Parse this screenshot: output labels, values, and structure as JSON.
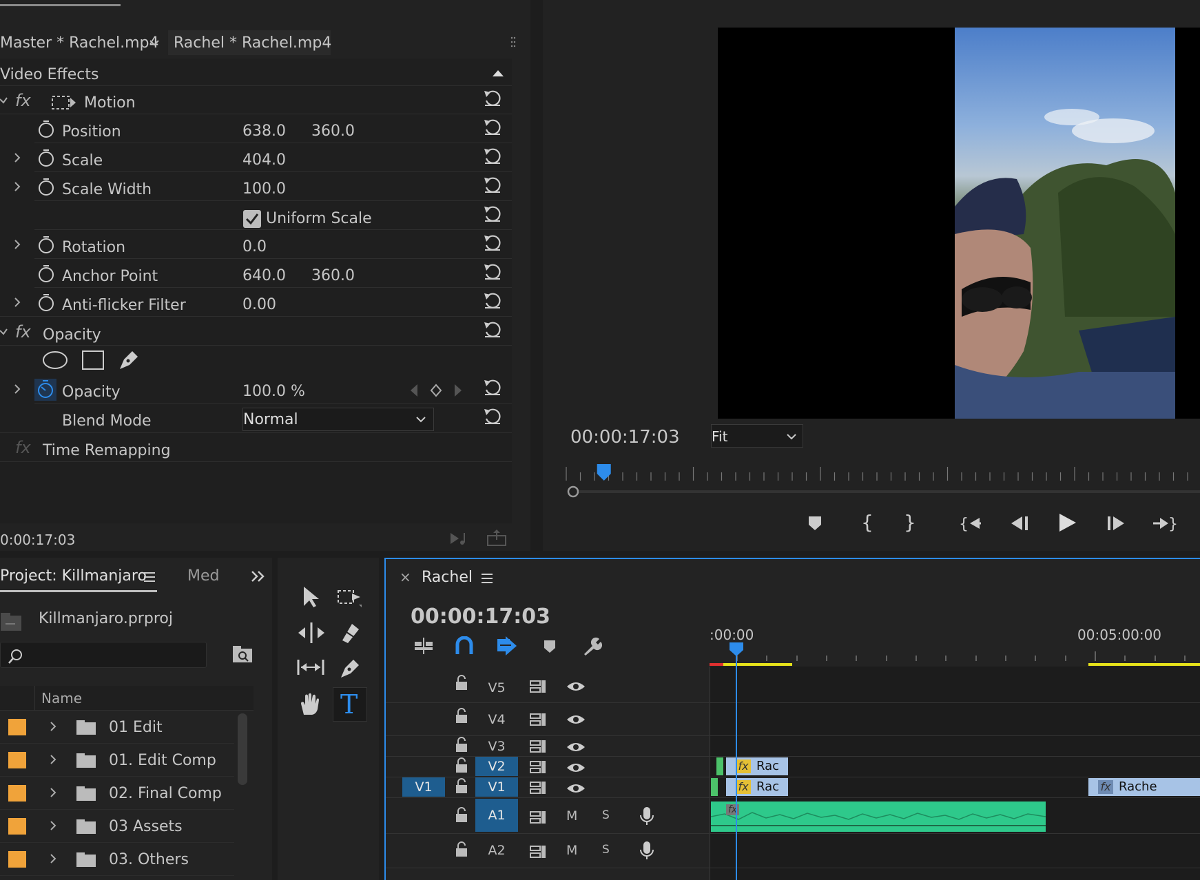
{
  "effect_controls": {
    "tab_master": "Master * Rachel.mp4",
    "tab_clip": "Rachel * Rachel.mp4",
    "section_title": "Video Effects",
    "motion_label": "Motion",
    "position": {
      "label": "Position",
      "x": "638.0",
      "y": "360.0"
    },
    "scale": {
      "label": "Scale",
      "value": "404.0"
    },
    "scale_width": {
      "label": "Scale Width",
      "value": "100.0"
    },
    "uniform_scale": {
      "label": "Uniform Scale",
      "checked": true
    },
    "rotation": {
      "label": "Rotation",
      "value": "0.0"
    },
    "anchor_point": {
      "label": "Anchor Point",
      "x": "640.0",
      "y": "360.0"
    },
    "anti_flicker": {
      "label": "Anti-flicker Filter",
      "value": "0.00"
    },
    "opacity_section": "Opacity",
    "opacity": {
      "label": "Opacity",
      "value": "100.0 %"
    },
    "blend_mode": {
      "label": "Blend Mode",
      "value": "Normal"
    },
    "time_remapping": "Time Remapping",
    "timecode": "0:00:17:03"
  },
  "program_monitor": {
    "timecode": "00:00:17:03",
    "zoom": "Fit",
    "playhead_fraction": 0.06
  },
  "project": {
    "tab_title": "Project: Killmanjaro",
    "tab_media": "Med",
    "file_name": "Killmanjaro.prproj",
    "search_placeholder": "",
    "column_name": "Name",
    "items": [
      {
        "label": "01 Edit",
        "color": "#f0a33a"
      },
      {
        "label": "01. Edit Comp",
        "color": "#f0a33a"
      },
      {
        "label": "02. Final Comp",
        "color": "#f0a33a"
      },
      {
        "label": "03 Assets",
        "color": "#f0a33a"
      },
      {
        "label": "03. Others",
        "color": "#f0a33a"
      }
    ]
  },
  "timeline": {
    "sequence_name": "Rachel",
    "timecode": "00:00:17:03",
    "ruler_start": ":00:00",
    "ruler_mid": "00:05:00:00",
    "source_patch": "V1",
    "tracks_video": [
      "V5",
      "V4",
      "V3",
      "V2",
      "V1"
    ],
    "tracks_audio": [
      "A1",
      "A2"
    ],
    "mute_label": "M",
    "solo_label": "S",
    "clip_v2": "Rac",
    "clip_v1": "Rac",
    "clip_v1_later": "Rache",
    "fx_badge": "fx"
  },
  "colors": {
    "accent": "#2d8ceb",
    "audio_clip": "#2ec98b",
    "video_clip": "#a7c3e6",
    "label_orange": "#f0a33a",
    "in_out_bar": "#e6e21a"
  }
}
